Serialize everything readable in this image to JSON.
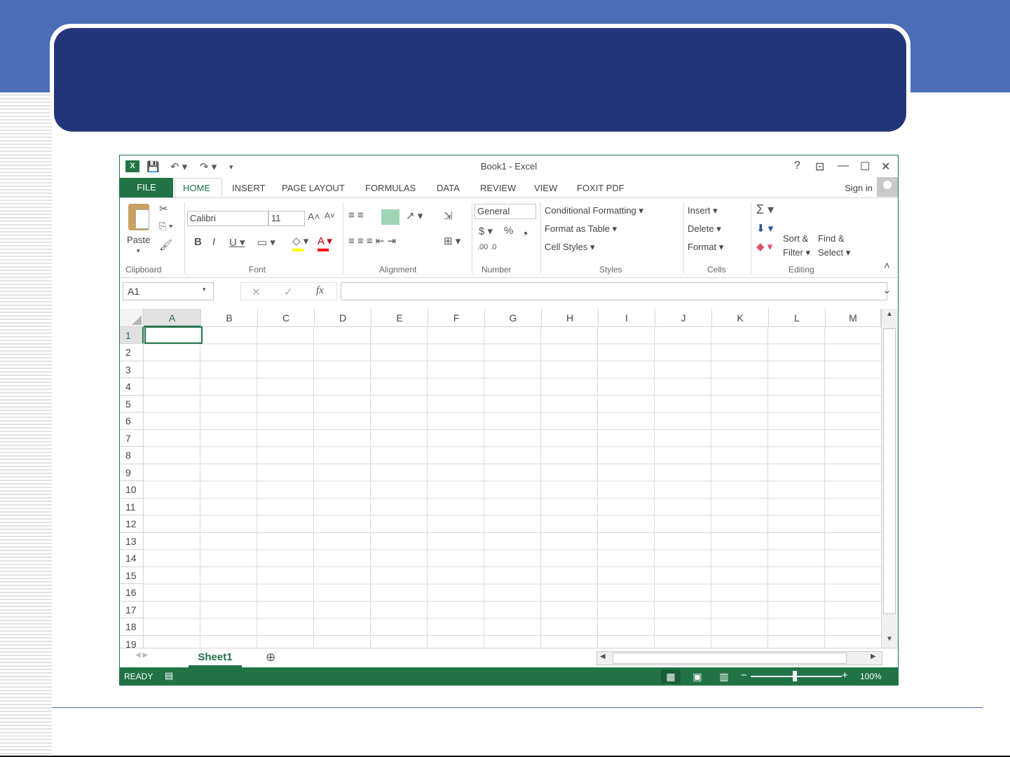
{
  "slide": {
    "title": ""
  },
  "excel": {
    "window_title": "Book1 - Excel",
    "qat": {
      "save": "💾",
      "undo": "↶ ▾",
      "redo": "↷ ▾",
      "customize": "▾",
      "logo": "X"
    },
    "window_buttons": {
      "help": "?",
      "ribbon_display": "⊡",
      "minimize": "—",
      "restore": "☐",
      "close": "✕"
    },
    "tabs": [
      "FILE",
      "HOME",
      "INSERT",
      "PAGE LAYOUT",
      "FORMULAS",
      "DATA",
      "REVIEW",
      "VIEW",
      "FOXIT PDF"
    ],
    "active_tab": "HOME",
    "sign_in": "Sign in",
    "ribbon": {
      "clipboard": {
        "label": "Clipboard",
        "paste": "Paste",
        "paste_arrow": "▾",
        "cut_icon": "✂",
        "copy_icon": "⎘ ▾",
        "painter_icon": "🖌"
      },
      "font": {
        "label": "Font",
        "name": "Calibri",
        "size": "11",
        "grow": "A˄",
        "shrink": "A˅",
        "bold": "B",
        "italic": "I",
        "underline": "U ▾",
        "border": "▭ ▾",
        "fill": "◇ ▾",
        "color": "A ▾"
      },
      "alignment": {
        "label": "Alignment",
        "top_row": "≡  ≡",
        "orient": "↗ ▾",
        "wrap": "⇲",
        "bottom_row": "≡  ≡  ≡  ⇤  ⇥",
        "merge": "⊞ ▾"
      },
      "number": {
        "label": "Number",
        "format": "General",
        "currency": "$ ▾",
        "percent": "%",
        "comma": "❟",
        "inc_dec": ".00 .0"
      },
      "styles": {
        "label": "Styles",
        "conditional": "Conditional Formatting ▾",
        "as_table": "Format as Table ▾",
        "cell_styles": "Cell Styles ▾"
      },
      "cells": {
        "label": "Cells",
        "insert": "Insert ▾",
        "delete": "Delete ▾",
        "format": "Format ▾"
      },
      "editing": {
        "label": "Editing",
        "sum": "Σ ▾",
        "fill": "⬇ ▾",
        "clear": "◆ ▾",
        "sort1": "Sort &",
        "sort2": "Filter ▾",
        "find1": "Find &",
        "find2": "Select ▾",
        "collapse": "˄"
      }
    },
    "formula_bar": {
      "name_box": "A1",
      "name_arrow": "▾",
      "cancel": "✕",
      "enter": "✓",
      "fx": "fx",
      "expand": "⌄"
    },
    "columns": [
      "A",
      "B",
      "C",
      "D",
      "E",
      "F",
      "G",
      "H",
      "I",
      "J",
      "K",
      "L",
      "M"
    ],
    "rows": [
      "1",
      "2",
      "3",
      "4",
      "5",
      "6",
      "7",
      "8",
      "9",
      "10",
      "11",
      "12",
      "13",
      "14",
      "15",
      "16",
      "17",
      "18",
      "19"
    ],
    "selected_cell": "A1",
    "sheet_nav": "◀  ▶",
    "sheet_tab": "Sheet1",
    "add_sheet": "⊕",
    "status": {
      "ready": "READY",
      "zoom": "100%",
      "minus": "−",
      "plus": "+"
    }
  }
}
